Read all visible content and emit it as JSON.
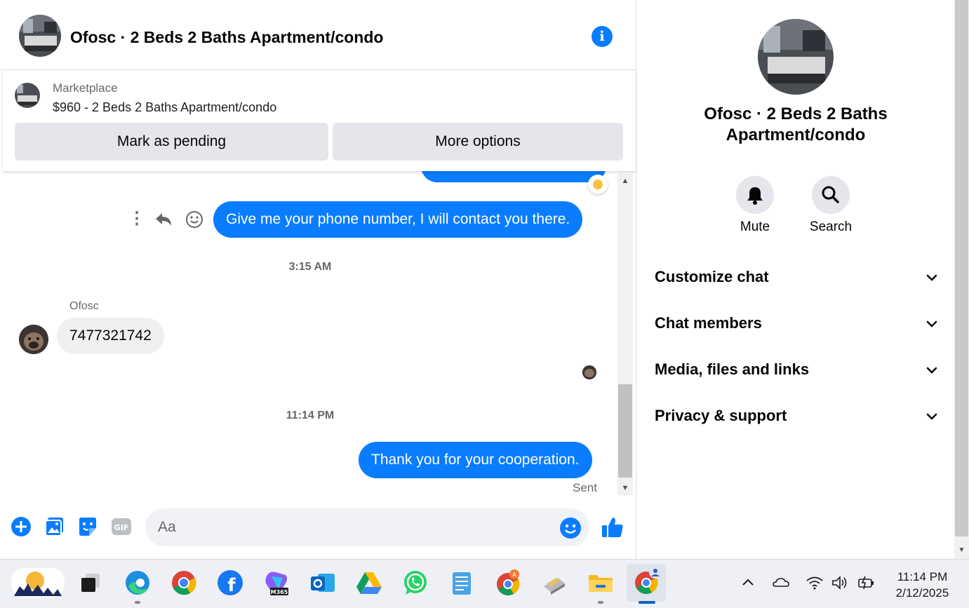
{
  "chat": {
    "title": "Ofosc · 2 Beds 2 Baths Apartment/condo",
    "marketplace_label": "Marketplace",
    "listing": "$960 - 2 Beds 2 Baths Apartment/condo",
    "mark_pending": "Mark as pending",
    "more_options": "More options"
  },
  "messages": {
    "out_1": "Give me your phone number, I will contact you there.",
    "timestamp_1": "3:15 AM",
    "sender_name": "Ofosc",
    "in_1": "7477321742",
    "timestamp_2": "11:14 PM",
    "out_2": "Thank you for your cooperation.",
    "status": "Sent"
  },
  "composer": {
    "placeholder": "Aa"
  },
  "info": {
    "title": "Ofosc · 2 Beds 2 Baths Apartment/condo",
    "mute_label": "Mute",
    "search_label": "Search",
    "sections": [
      "Customize chat",
      "Chat members",
      "Media, files and links",
      "Privacy & support"
    ]
  },
  "taskbar": {
    "time": "11:14 PM",
    "date": "2/12/2025",
    "apps": [
      "weather",
      "task-view",
      "edge",
      "chrome",
      "facebook",
      "m365-copilot",
      "outlook",
      "google-drive",
      "whatsapp",
      "notepad",
      "chrome-profile",
      "usb-drive",
      "file-explorer",
      "chrome-active"
    ]
  },
  "colors": {
    "messenger_blue": "#0a7cff",
    "incoming_bubble": "#f0f0f0",
    "button_gray": "#e4e6eb"
  }
}
